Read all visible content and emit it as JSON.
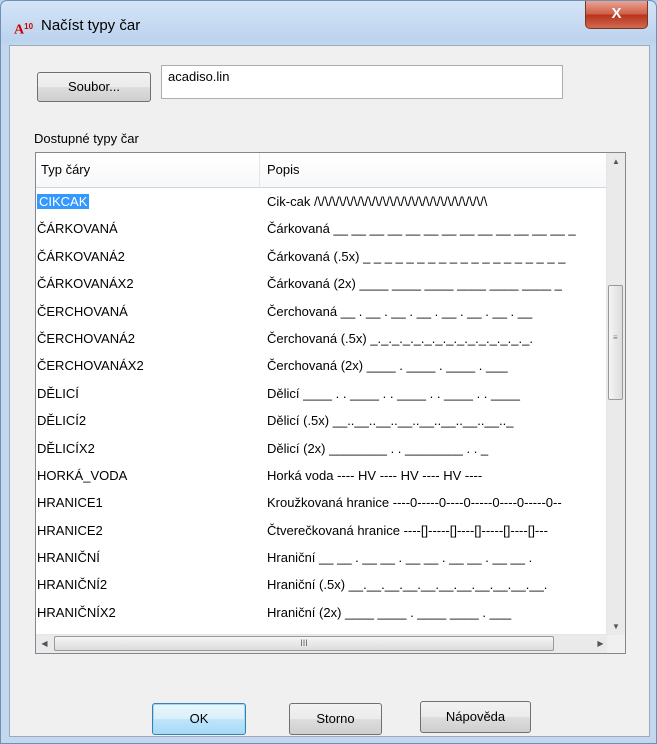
{
  "window": {
    "title": "Načíst typy čar",
    "app_icon": "autocad-app-icon",
    "close_glyph": "X"
  },
  "file": {
    "button_label": "Soubor...",
    "value": "acadiso.lin"
  },
  "list": {
    "label": "Dostupné typy čar",
    "columns": [
      "Typ čáry",
      "Popis"
    ],
    "selected_index": 0,
    "rows": [
      {
        "name": "CIKCAK",
        "desc": "Cik-cak /\\/\\/\\/\\/\\/\\/\\/\\/\\/\\/\\/\\/\\/\\/\\/\\/\\/\\/\\/\\/\\/\\/\\/\\"
      },
      {
        "name": "ČÁRKOVANÁ",
        "desc": "Čárkovaná __ __ __ __ __ __ __ __ __ __ __ __ __ _"
      },
      {
        "name": "ČÁRKOVANÁ2",
        "desc": "Čárkovaná (.5x) _ _ _ _ _ _ _ _ _ _ _ _ _ _ _ _ _ _ _"
      },
      {
        "name": "ČÁRKOVANÁX2",
        "desc": "Čárkovaná (2x) ____  ____  ____  ____  ____  ____  _"
      },
      {
        "name": "ČERCHOVANÁ",
        "desc": "Čerchovaná __ . __ . __ . __ . __ . __ . __ . __"
      },
      {
        "name": "ČERCHOVANÁ2",
        "desc": "Čerchovaná (.5x) _._._._._._._._._._._._._._._."
      },
      {
        "name": "ČERCHOVANÁX2",
        "desc": "Čerchovaná (2x) ____  .  ____  .  ____  .  ___"
      },
      {
        "name": "DĚLICÍ",
        "desc": "Dělicí ____ . . ____ . . ____ . . ____ . . ____"
      },
      {
        "name": "DĚLICÍ2",
        "desc": "Dělicí (.5x) __..__..__..__..__..__..__..__.._"
      },
      {
        "name": "DĚLICÍX2",
        "desc": "Dělicí (2x) ________  .  .  ________  .  .  _"
      },
      {
        "name": "HORKÁ_VODA",
        "desc": "Horká voda ---- HV ---- HV ---- HV ----"
      },
      {
        "name": "HRANICE1",
        "desc": "Kroužkovaná hranice ----0-----0----0-----0----0-----0--"
      },
      {
        "name": "HRANICE2",
        "desc": "Čtverečkovaná hranice ----[]-----[]----[]-----[]----[]---"
      },
      {
        "name": "HRANIČNÍ",
        "desc": "Hraniční __ __ . __ __ . __ __ . __ __ . __ __ ."
      },
      {
        "name": "HRANIČNÍ2",
        "desc": "Hraniční (.5x) __.__.__.__.__.__.__.__.__.__.__."
      },
      {
        "name": "HRANIČNÍX2",
        "desc": "Hraniční (2x) ____  ____  .  ____  ____  .  ___"
      }
    ],
    "scroll_up_glyph": "▲",
    "scroll_down_glyph": "▼",
    "scroll_left_glyph": "◀",
    "scroll_right_glyph": "▶",
    "hthumb_grip": "III"
  },
  "buttons": {
    "ok": "OK",
    "cancel": "Storno",
    "help": "Nápověda"
  }
}
